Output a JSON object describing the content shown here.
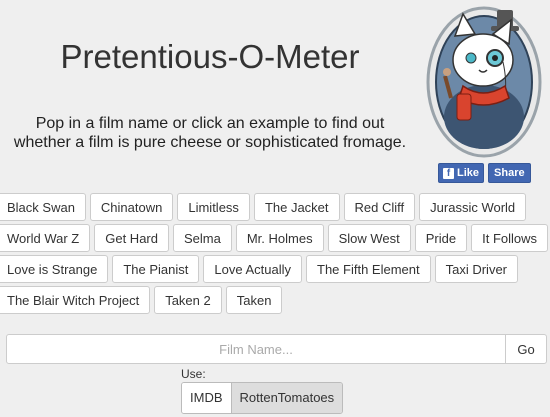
{
  "header": {
    "title": "Pretentious-O-Meter",
    "subtitle_line1": "Pop in a film name or click an example to find out",
    "subtitle_line2": "whether a film is pure cheese or sophisticated fromage."
  },
  "social": {
    "like_label": "Like",
    "share_label": "Share",
    "fb_glyph": "f"
  },
  "films": {
    "row1": [
      "Black Swan",
      "Chinatown",
      "Limitless",
      "The Jacket",
      "Red Cliff",
      "Jurassic World"
    ],
    "row2": [
      "World War Z",
      "Get Hard",
      "Selma",
      "Mr. Holmes",
      "Slow West",
      "Pride",
      "It Follows"
    ],
    "row3": [
      "Love is Strange",
      "The Pianist",
      "Love Actually",
      "The Fifth Element",
      "Taxi Driver"
    ],
    "row4": [
      "The Blair Witch Project",
      "Taken 2",
      "Taken"
    ]
  },
  "search": {
    "placeholder": "Film Name...",
    "value": "",
    "go_label": "Go"
  },
  "source": {
    "label": "Use:",
    "options": [
      "IMDB",
      "RottenTomatoes"
    ],
    "selected": "RottenTomatoes"
  }
}
